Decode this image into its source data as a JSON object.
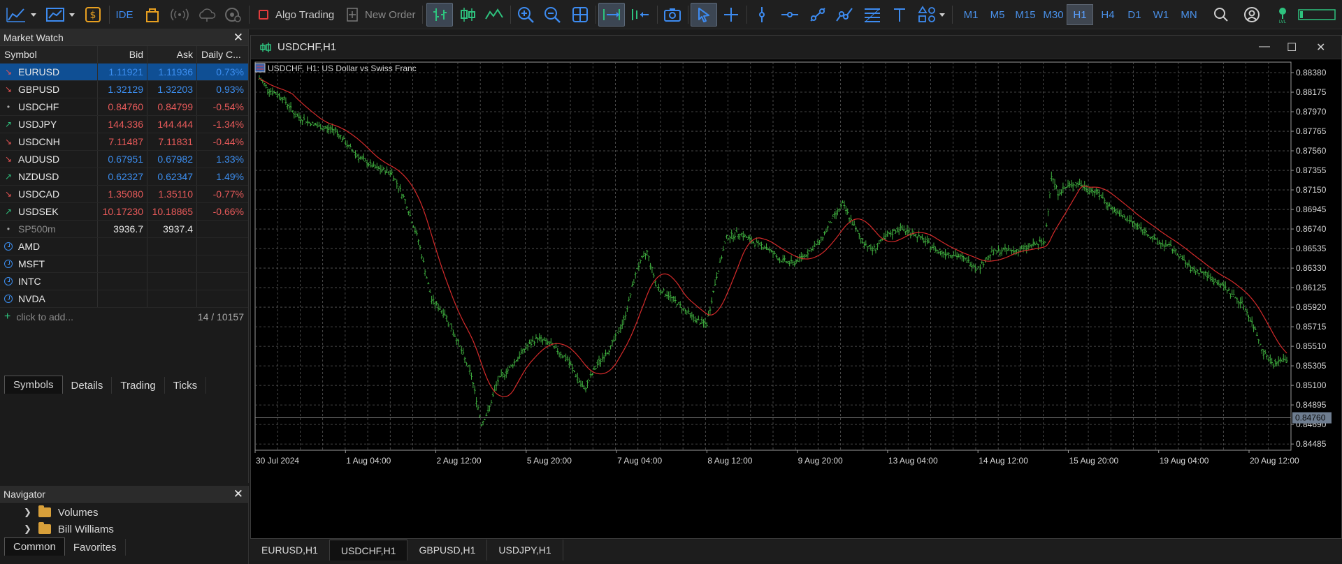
{
  "toolbar": {
    "algo_trading": "Algo Trading",
    "new_order": "New Order",
    "ide": "IDE",
    "timeframes": [
      "M1",
      "M5",
      "M15",
      "M30",
      "H1",
      "H4",
      "D1",
      "W1",
      "MN"
    ],
    "active_timeframe": "H1"
  },
  "market_watch": {
    "title": "Market Watch",
    "columns": [
      "Symbol",
      "Bid",
      "Ask",
      "Daily C..."
    ],
    "rows": [
      {
        "symbol": "EURUSD",
        "bid": "1.11921",
        "ask": "1.11936",
        "change": "0.73%",
        "dir": "down",
        "color": "blue",
        "selected": true
      },
      {
        "symbol": "GBPUSD",
        "bid": "1.32129",
        "ask": "1.32203",
        "change": "0.93%",
        "dir": "down",
        "color": "blue"
      },
      {
        "symbol": "USDCHF",
        "bid": "0.84760",
        "ask": "0.84799",
        "change": "-0.54%",
        "dir": "dot",
        "color": "red"
      },
      {
        "symbol": "USDJPY",
        "bid": "144.336",
        "ask": "144.444",
        "change": "-1.34%",
        "dir": "up",
        "color": "red"
      },
      {
        "symbol": "USDCNH",
        "bid": "7.11487",
        "ask": "7.11831",
        "change": "-0.44%",
        "dir": "down",
        "color": "red"
      },
      {
        "symbol": "AUDUSD",
        "bid": "0.67951",
        "ask": "0.67982",
        "change": "1.33%",
        "dir": "down",
        "color": "blue"
      },
      {
        "symbol": "NZDUSD",
        "bid": "0.62327",
        "ask": "0.62347",
        "change": "1.49%",
        "dir": "up",
        "color": "blue"
      },
      {
        "symbol": "USDCAD",
        "bid": "1.35080",
        "ask": "1.35110",
        "change": "-0.77%",
        "dir": "down",
        "color": "red"
      },
      {
        "symbol": "USDSEK",
        "bid": "10.17230",
        "ask": "10.18865",
        "change": "-0.66%",
        "dir": "up",
        "color": "red"
      },
      {
        "symbol": "SP500m",
        "bid": "3936.7",
        "ask": "3937.4",
        "change": "",
        "dir": "dot",
        "color": "white",
        "dim": true
      },
      {
        "symbol": "AMD",
        "bid": "",
        "ask": "",
        "change": "",
        "dir": "clock",
        "color": "white"
      },
      {
        "symbol": "MSFT",
        "bid": "",
        "ask": "",
        "change": "",
        "dir": "clock",
        "color": "white"
      },
      {
        "symbol": "INTC",
        "bid": "",
        "ask": "",
        "change": "",
        "dir": "clock",
        "color": "white"
      },
      {
        "symbol": "NVDA",
        "bid": "",
        "ask": "",
        "change": "",
        "dir": "clock",
        "color": "white"
      }
    ],
    "add_label": "click to add...",
    "count": "14 / 10157",
    "tabs": [
      "Symbols",
      "Details",
      "Trading",
      "Ticks"
    ],
    "active_tab": "Symbols"
  },
  "navigator": {
    "title": "Navigator",
    "items": [
      "Volumes",
      "Bill Williams"
    ],
    "tabs": [
      "Common",
      "Favorites"
    ],
    "active_tab": "Common"
  },
  "chart_window": {
    "title": "USDCHF,H1",
    "label": "USDCHF, H1:  US Dollar vs Swiss Franc",
    "bottom_tabs": [
      "EURUSD,H1",
      "USDCHF,H1",
      "GBPUSD,H1",
      "USDJPY,H1"
    ],
    "active_tab": "USDCHF,H1"
  },
  "chart_data": {
    "type": "candlestick",
    "symbol": "USDCHF",
    "timeframe": "H1",
    "y_ticks": [
      "0.88380",
      "0.88175",
      "0.87970",
      "0.87765",
      "0.87560",
      "0.87355",
      "0.87150",
      "0.86945",
      "0.86740",
      "0.86535",
      "0.86330",
      "0.86125",
      "0.85920",
      "0.85715",
      "0.85510",
      "0.85305",
      "0.85100",
      "0.84895",
      "0.84690",
      "0.84485"
    ],
    "ylim": [
      0.8442,
      0.8849
    ],
    "current_price": "0.84760",
    "x_ticks": [
      "30 Jul 2024",
      "1 Aug 04:00",
      "2 Aug 12:00",
      "5 Aug 20:00",
      "7 Aug 04:00",
      "8 Aug 12:00",
      "9 Aug 20:00",
      "13 Aug 04:00",
      "14 Aug 12:00",
      "15 Aug 20:00",
      "19 Aug 04:00",
      "20 Aug 12:00"
    ],
    "grid": true,
    "ma_color": "#d42a2a",
    "bar_color": "#3fae3f",
    "close_path": [
      [
        0,
        0.8832
      ],
      [
        6,
        0.882
      ],
      [
        14,
        0.8812
      ],
      [
        22,
        0.8793
      ],
      [
        30,
        0.8786
      ],
      [
        38,
        0.878
      ],
      [
        46,
        0.8778
      ],
      [
        54,
        0.876
      ],
      [
        62,
        0.8747
      ],
      [
        70,
        0.8738
      ],
      [
        80,
        0.8733
      ],
      [
        88,
        0.8704
      ],
      [
        96,
        0.8662
      ],
      [
        104,
        0.86
      ],
      [
        112,
        0.8585
      ],
      [
        120,
        0.8555
      ],
      [
        128,
        0.852
      ],
      [
        134,
        0.847
      ],
      [
        138,
        0.8482
      ],
      [
        144,
        0.8515
      ],
      [
        152,
        0.853
      ],
      [
        160,
        0.8548
      ],
      [
        168,
        0.856
      ],
      [
        176,
        0.8553
      ],
      [
        186,
        0.8537
      ],
      [
        196,
        0.8505
      ],
      [
        204,
        0.8532
      ],
      [
        212,
        0.855
      ],
      [
        220,
        0.8578
      ],
      [
        228,
        0.8633
      ],
      [
        234,
        0.865
      ],
      [
        240,
        0.8613
      ],
      [
        248,
        0.8603
      ],
      [
        256,
        0.859
      ],
      [
        264,
        0.8578
      ],
      [
        270,
        0.8574
      ],
      [
        276,
        0.8625
      ],
      [
        282,
        0.8665
      ],
      [
        290,
        0.867
      ],
      [
        298,
        0.866
      ],
      [
        306,
        0.8655
      ],
      [
        314,
        0.8642
      ],
      [
        322,
        0.8638
      ],
      [
        330,
        0.8648
      ],
      [
        338,
        0.866
      ],
      [
        346,
        0.8685
      ],
      [
        352,
        0.87
      ],
      [
        358,
        0.868
      ],
      [
        364,
        0.8661
      ],
      [
        370,
        0.8652
      ],
      [
        378,
        0.8665
      ],
      [
        386,
        0.8675
      ],
      [
        394,
        0.867
      ],
      [
        402,
        0.8661
      ],
      [
        410,
        0.865
      ],
      [
        418,
        0.8648
      ],
      [
        426,
        0.8642
      ],
      [
        434,
        0.8633
      ],
      [
        442,
        0.8649
      ],
      [
        450,
        0.8652
      ],
      [
        458,
        0.8651
      ],
      [
        466,
        0.8657
      ],
      [
        474,
        0.866
      ],
      [
        478,
        0.873
      ],
      [
        482,
        0.8712
      ],
      [
        488,
        0.8719
      ],
      [
        494,
        0.8722
      ],
      [
        500,
        0.8716
      ],
      [
        506,
        0.8712
      ],
      [
        512,
        0.87
      ],
      [
        518,
        0.869
      ],
      [
        526,
        0.8682
      ],
      [
        534,
        0.8672
      ],
      [
        542,
        0.866
      ],
      [
        550,
        0.8655
      ],
      [
        556,
        0.8645
      ],
      [
        562,
        0.8632
      ],
      [
        570,
        0.8628
      ],
      [
        576,
        0.862
      ],
      [
        582,
        0.8614
      ],
      [
        588,
        0.8604
      ],
      [
        594,
        0.8594
      ],
      [
        600,
        0.8572
      ],
      [
        606,
        0.8545
      ],
      [
        612,
        0.8532
      ],
      [
        617,
        0.8537
      ]
    ]
  }
}
